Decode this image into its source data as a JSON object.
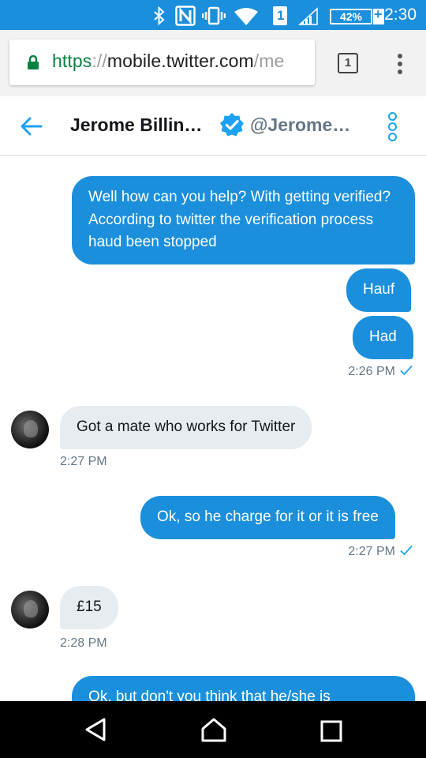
{
  "status_bar": {
    "battery": "42%",
    "sim_slot": "1",
    "time": "2:30"
  },
  "browser": {
    "url_scheme": "https",
    "url_sep": "://",
    "url_host": "mobile.twitter.com",
    "url_path": "/me",
    "tab_count": "1"
  },
  "conversation": {
    "name": "Jerome Billin…",
    "handle": "@Jerome…"
  },
  "messages": [
    {
      "side": "sent",
      "text": "Well how can you help?  With getting verified?  According to twitter the verification process haud been stopped"
    },
    {
      "side": "sent",
      "text": "Hauf"
    },
    {
      "side": "sent",
      "text": "Had"
    },
    {
      "side": "received",
      "text": "Got a mate who works for Twitter"
    },
    {
      "side": "sent",
      "text": "Ok, so he charge for it or it is free"
    },
    {
      "side": "received",
      "text": "£15"
    },
    {
      "side": "sent",
      "text": "Ok, but don't you think that he/she is"
    }
  ],
  "timestamps": [
    "2:26 PM",
    "2:27 PM",
    "2:27 PM",
    "2:28 PM"
  ],
  "colors": {
    "status_bar": "#1b8fdb",
    "sent_bubble": "#1b8fdb",
    "received_bubble": "#e6ecf0",
    "twitter_blue": "#1da1f2",
    "secure_green": "#0b8043"
  },
  "icons": [
    "bluetooth-icon",
    "nfc-icon",
    "vibrate-icon",
    "wifi-icon",
    "signal-icon",
    "battery-icon",
    "lock-icon",
    "back-arrow-icon",
    "verified-icon",
    "more-icon",
    "check-icon",
    "back-nav-icon",
    "home-nav-icon",
    "recents-nav-icon"
  ]
}
